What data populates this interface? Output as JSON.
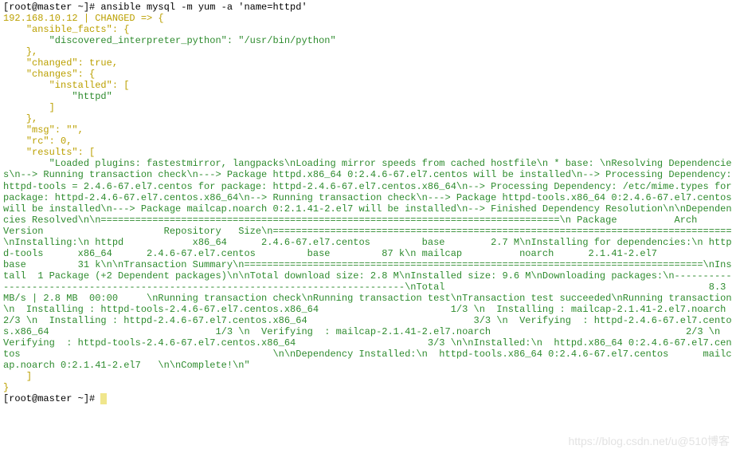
{
  "prompt": "[root@master ~]# ansible mysql -m yum -a 'name=httpd'",
  "header": "192.168.10.12 | CHANGED => {",
  "facts": {
    "l1": "    \"ansible_facts\": {",
    "l2": "        \"discovered_interpreter_python\": \"/usr/bin/python\"",
    "l3": "    },",
    "l4": "    \"changed\": true,",
    "l5": "    \"changes\": {",
    "l6": "        \"installed\": [",
    "l7": "            \"httpd\"",
    "l8": "        ]",
    "l9": "    },",
    "l10": "    \"msg\": \"\",",
    "l11": "    \"rc\": 0,",
    "l12": "    \"results\": ["
  },
  "results": "        \"Loaded plugins: fastestmirror, langpacks\\nLoading mirror speeds from cached hostfile\\n * base: \\nResolving Dependencies\\n--> Running transaction check\\n---> Package httpd.x86_64 0:2.4.6-67.el7.centos will be installed\\n--> Processing Dependency: httpd-tools = 2.4.6-67.el7.centos for package: httpd-2.4.6-67.el7.centos.x86_64\\n--> Processing Dependency: /etc/mime.types for package: httpd-2.4.6-67.el7.centos.x86_64\\n--> Running transaction check\\n---> Package httpd-tools.x86_64 0:2.4.6-67.el7.centos will be installed\\n---> Package mailcap.noarch 0:2.1.41-2.el7 will be installed\\n--> Finished Dependency Resolution\\n\\nDependencies Resolved\\n\\n================================================================================\\n Package          Arch        Version                     Repository   Size\\n================================================================================\\nInstalling:\\n httpd            x86_64      2.4.6-67.el7.centos         base        2.7 M\\nInstalling for dependencies:\\n httpd-tools      x86_64      2.4.6-67.el7.centos         base         87 k\\n mailcap          noarch      2.1.41-2.el7                base         31 k\\n\\nTransaction Summary\\n================================================================================\\nInstall  1 Package (+2 Dependent packages)\\n\\nTotal download size: 2.8 M\\nInstalled size: 9.6 M\\nDownloading packages:\\n--------------------------------------------------------------------------------\\nTotal                                              8.3 MB/s | 2.8 MB  00:00     \\nRunning transaction check\\nRunning transaction test\\nTransaction test succeeded\\nRunning transaction\\n  Installing : httpd-tools-2.4.6-67.el7.centos.x86_64                       1/3 \\n  Installing : mailcap-2.1.41-2.el7.noarch                                  2/3 \\n  Installing : httpd-2.4.6-67.el7.centos.x86_64                             3/3 \\n  Verifying  : httpd-2.4.6-67.el7.centos.x86_64                             1/3 \\n  Verifying  : mailcap-2.1.41-2.el7.noarch                                  2/3 \\n  Verifying  : httpd-tools-2.4.6-67.el7.centos.x86_64                       3/3 \\n\\nInstalled:\\n  httpd.x86_64 0:2.4.6-67.el7.centos                                            \\n\\nDependency Installed:\\n  httpd-tools.x86_64 0:2.4.6-67.el7.centos      mailcap.noarch 0:2.1.41-2.el7   \\n\\nComplete!\\n\"",
  "closing": {
    "l1": "    ]",
    "l2": "}",
    "l3": "[root@master ~]# "
  },
  "watermark": "https://blog.csdn.net/u@510博客"
}
